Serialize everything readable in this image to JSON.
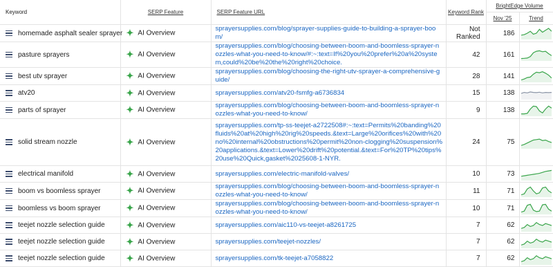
{
  "headers": {
    "keyword": "Keyword",
    "serp_feature": "SERP Feature",
    "serp_url": "SERP Feature URL",
    "keyword_rank": "Keyword Rank",
    "brightedge_volume": "BrightEdge Volume",
    "nov": "Nov '25",
    "trend": "Trend"
  },
  "rows": [
    {
      "keyword": "homemade asphalt sealer sprayer",
      "feature": "AI Overview",
      "url": "sprayersupplies.com/blog/sprayer-supplies-guide-to-building-a-sprayer-boom/",
      "rank": "Not Ranked",
      "volume": "186",
      "trend_color": "#3aa54b",
      "trend": [
        0.3,
        0.35,
        0.5,
        0.7,
        0.4,
        0.5,
        0.9,
        0.6,
        0.8,
        1.0,
        0.7
      ]
    },
    {
      "keyword": "pasture sprayers",
      "feature": "AI Overview",
      "url": "sprayersupplies.com/blog/choosing-between-boom-and-boomless-sprayer-nozzles-what-you-need-to-know/#:~:text=If%20you%20prefer%20a%20system,could%20be%20the%20right%20choice.",
      "rank": "42",
      "volume": "161",
      "trend_color": "#3aa54b",
      "trend": [
        0.1,
        0.12,
        0.15,
        0.3,
        0.7,
        0.85,
        0.9,
        0.8,
        0.85,
        0.6,
        0.4
      ]
    },
    {
      "keyword": "best utv sprayer",
      "feature": "AI Overview",
      "url": "sprayersupplies.com/blog/choosing-the-right-utv-sprayer-a-comprehensive-guide/",
      "rank": "28",
      "volume": "141",
      "trend_color": "#3aa54b",
      "trend": [
        0.1,
        0.2,
        0.35,
        0.4,
        0.7,
        0.9,
        0.85,
        0.95,
        0.8,
        0.6,
        0.3
      ]
    },
    {
      "keyword": "atv20",
      "feature": "AI Overview",
      "url": "sprayersupplies.com/atv20-fsmfg-a6736834",
      "rank": "15",
      "volume": "138",
      "trend_color": "#8a94a6",
      "trend": [
        0.5,
        0.6,
        0.55,
        0.65,
        0.6,
        0.58,
        0.62,
        0.55,
        0.6,
        0.58,
        0.6
      ]
    },
    {
      "keyword": "parts of sprayer",
      "feature": "AI Overview",
      "url": "sprayersupplies.com/blog/choosing-between-boom-and-boomless-sprayer-nozzles-what-you-need-to-know/",
      "rank": "9",
      "volume": "138",
      "trend_color": "#3aa54b",
      "trend": [
        0.1,
        0.1,
        0.15,
        0.6,
        0.9,
        0.85,
        0.4,
        0.2,
        0.6,
        0.9,
        0.7
      ]
    },
    {
      "keyword": "solid stream nozzle",
      "feature": "AI Overview",
      "url": "sprayersupplies.com/tp-ss-teejet-a2722508#:~:text=Permits%20banding%20fluids%20at%20high%20rig%20speeds.&text=Large%20orifices%20with%20no%20internal%20obstructions%20permit%20non-clogging%20suspension%20applications.&text=Lower%20drift%20potential.&text=For%20TP%20tips%20use%20Quick,gasket%2025608-1-NYR.",
      "rank": "24",
      "volume": "75",
      "trend_color": "#3aa54b",
      "trend": [
        0.2,
        0.3,
        0.45,
        0.6,
        0.75,
        0.8,
        0.85,
        0.7,
        0.75,
        0.6,
        0.5
      ]
    },
    {
      "keyword": "electrical manifold",
      "feature": "AI Overview",
      "url": "sprayersupplies.com/electric-manifold-valves/",
      "rank": "10",
      "volume": "73",
      "trend_color": "#3aa54b",
      "trend": [
        0.3,
        0.35,
        0.4,
        0.45,
        0.5,
        0.55,
        0.6,
        0.7,
        0.8,
        0.85,
        0.9
      ]
    },
    {
      "keyword": "boom vs boomless sprayer",
      "feature": "AI Overview",
      "url": "sprayersupplies.com/blog/choosing-between-boom-and-boomless-sprayer-nozzles-what-you-need-to-know/",
      "rank": "11",
      "volume": "71",
      "trend_color": "#3aa54b",
      "trend": [
        0.1,
        0.2,
        0.7,
        0.9,
        0.5,
        0.2,
        0.3,
        0.8,
        0.9,
        0.5,
        0.3
      ]
    },
    {
      "keyword": "boomless vs boom sprayer",
      "feature": "AI Overview",
      "url": "sprayersupplies.com/blog/choosing-between-boom-and-boomless-sprayer-nozzles-what-you-need-to-know/",
      "rank": "10",
      "volume": "71",
      "trend_color": "#3aa54b",
      "trend": [
        0.1,
        0.2,
        0.8,
        0.9,
        0.3,
        0.15,
        0.2,
        0.85,
        0.9,
        0.4,
        0.2
      ]
    },
    {
      "keyword": "teejet nozzle selection guide",
      "feature": "AI Overview",
      "url": "sprayersupplies.com/aic110-vs-teejet-a8261725",
      "rank": "7",
      "volume": "62",
      "trend_color": "#3aa54b",
      "trend": [
        0.2,
        0.3,
        0.6,
        0.4,
        0.5,
        0.8,
        0.6,
        0.5,
        0.7,
        0.6,
        0.5
      ]
    },
    {
      "keyword": "teejet nozzle selection guide",
      "feature": "AI Overview",
      "url": "sprayersupplies.com/teejet-nozzles/",
      "rank": "7",
      "volume": "62",
      "trend_color": "#3aa54b",
      "trend": [
        0.2,
        0.3,
        0.6,
        0.4,
        0.5,
        0.8,
        0.6,
        0.5,
        0.7,
        0.6,
        0.5
      ]
    },
    {
      "keyword": "teejet nozzle selection guide",
      "feature": "AI Overview",
      "url": "sprayersupplies.com/tk-teejet-a7058822",
      "rank": "7",
      "volume": "62",
      "trend_color": "#3aa54b",
      "trend": [
        0.2,
        0.3,
        0.6,
        0.4,
        0.5,
        0.8,
        0.6,
        0.5,
        0.7,
        0.6,
        0.5
      ]
    }
  ]
}
